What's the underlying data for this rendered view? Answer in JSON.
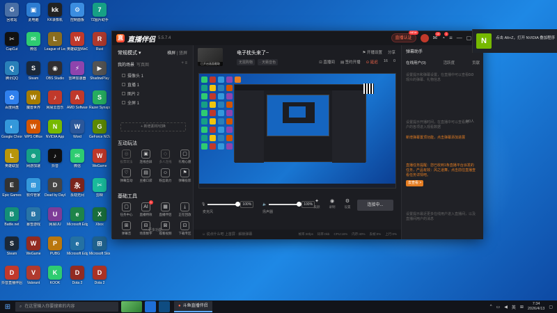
{
  "window": {
    "app_title": "直播伴侣",
    "version": "5.5.7.4",
    "cert_label": "直播认证",
    "cert_badge": "NEW",
    "notif_badge": "10",
    "notif_badge2": "1"
  },
  "left": {
    "mode_label": "常规模式 ▾",
    "mode_h": "横屏",
    "mode_v": "竖屏",
    "scene_title": "我的场景",
    "scene_sub": "写真图",
    "scene_ops": "+ ≡",
    "sources": [
      "摄像头 1",
      "直播 1",
      "图片 2",
      "全屏 1"
    ],
    "add_source": "+ 新增素材/切换",
    "section1": "互动玩法",
    "grid1": [
      {
        "icon": "◎",
        "label": "投票玩法",
        "dim": true
      },
      {
        "icon": "▣",
        "label": "连线合屏",
        "dim": false
      },
      {
        "icon": "◇",
        "label": "多人连线",
        "dim": true
      },
      {
        "icon": "▢",
        "label": "礼物心愿",
        "dim": false
      },
      {
        "icon": "♡",
        "label": "弹幕互动",
        "dim": false
      },
      {
        "icon": "▤",
        "label": "主播口袋",
        "dim": false
      },
      {
        "icon": "☺",
        "label": "粉丝助力",
        "dim": false
      },
      {
        "icon": "⚑",
        "label": "弹幕投影",
        "dim": false
      }
    ],
    "section2": "基础工具",
    "grid2": [
      {
        "icon": "▢",
        "label": "任务中心",
        "dim": false
      },
      {
        "icon": "AI",
        "label": "直播特效",
        "dim": false,
        "badge": "1"
      },
      {
        "icon": "▦",
        "label": "直播伴侣",
        "dim": false
      },
      {
        "icon": "⤓",
        "label": "正在回放",
        "dim": false
      },
      {
        "icon": "⊞",
        "label": "弹幕音",
        "dim": false
      },
      {
        "icon": "⊟",
        "label": "场景数字",
        "dim": false
      },
      {
        "icon": "⊠",
        "label": "观看视频",
        "dim": false
      },
      {
        "icon": "⊡",
        "label": "下载专区",
        "dim": false
      }
    ],
    "more": "••• 更多功能"
  },
  "center": {
    "thumb_label": "已开启画面截取",
    "room_title": "电子枕头来了~",
    "top_links": [
      "⚑ 开播设置",
      "分享"
    ],
    "tags": [
      "无需购物",
      "· 天籁音色"
    ],
    "top_links2": [
      "⊡ 直播间",
      "▤ 签约开播",
      "⊙ 延迟"
    ],
    "top_counts": [
      "16",
      "0"
    ],
    "controls": {
      "mic_label": "麦克风",
      "mic_pct": "100%",
      "speaker_label": "扬声器",
      "speaker_pct": "100%",
      "mic_value": 1.0,
      "speaker_value": 1.0,
      "icons": [
        {
          "icon": "✦",
          "label": "美颜"
        },
        {
          "icon": "◉",
          "label": "录制"
        },
        {
          "icon": "⚙",
          "label": "设置"
        }
      ],
      "live_button": "连接中..."
    },
    "chat_placeholder": "☺ 说点什么吧 上首屏 · 解锁弹幕",
    "stats": [
      "帧率:30fps",
      "码率:0kb",
      "CPU:16%",
      "内存:40%",
      "丢帧:0%",
      "上行:0%"
    ]
  },
  "right": {
    "header": "弹幕助手",
    "tabs": [
      "在线用户(0)",
      "活跃度",
      "贡献"
    ],
    "note1": "设置提示和弹幕设置，在直播中可以查看观众的弹幕、礼物信息",
    "count1": "0.0",
    "note2": "设置提示开播时间，在直播中可以查看用户的各项进入观看数据",
    "count2": "0/0人",
    "hl1": "新增弹幕置顶功能，点击弹幕添加进展",
    "hl2": "直播任务提醒：您已收到1条直播平台派发的任务，产品有效：风之道舞，点击前往直播查看任务详情吧。",
    "go_view": "去查看 >",
    "note3": "设置提示最近更多在线用户进入直播间，以及直播间用户的消息"
  },
  "notification": {
    "text": "点击 Alt+Z，打开 NVIDIA 叠加程序"
  },
  "desktop": {
    "icons": [
      {
        "label": "回收站",
        "color": "#4a6fa5",
        "glyph": "♻"
      },
      {
        "label": "此电脑",
        "color": "#2d7dd2",
        "glyph": "▣"
      },
      {
        "label": "KK录像机",
        "color": "#222",
        "glyph": "kk"
      },
      {
        "label": "控制面板",
        "color": "#3b8de0",
        "glyph": "⚙"
      },
      {
        "label": "7Z图片助手",
        "color": "#16a085",
        "glyph": "7"
      },
      {
        "label": "CapCut",
        "color": "#111",
        "glyph": "✂"
      },
      {
        "label": "微信",
        "color": "#2ecc71",
        "glyph": "✉"
      },
      {
        "label": "League of Legends",
        "color": "#8a6d1f",
        "glyph": "L"
      },
      {
        "label": "英雄联盟WeGame",
        "color": "#c0392b",
        "glyph": "W"
      },
      {
        "label": "Rust",
        "color": "#b03a2e",
        "glyph": "R"
      },
      {
        "label": "腾讯QQ",
        "color": "#2980b9",
        "glyph": "Q"
      },
      {
        "label": "Steam",
        "color": "#1b2838",
        "glyph": "S"
      },
      {
        "label": "OBS Studio",
        "color": "#302e31",
        "glyph": "◉"
      },
      {
        "label": "雷神加速器",
        "color": "#8e44ad",
        "glyph": "⚡"
      },
      {
        "label": "ShadowPlay",
        "color": "#555",
        "glyph": "▶"
      },
      {
        "label": "百度网盘",
        "color": "#2f80ed",
        "glyph": "✿"
      },
      {
        "label": "魔兽世界",
        "color": "#a67c00",
        "glyph": "W"
      },
      {
        "label": "网易云音乐",
        "color": "#c0392b",
        "glyph": "♪"
      },
      {
        "label": "AMD Software",
        "color": "#c0392b",
        "glyph": "A"
      },
      {
        "label": "Razer Synapse",
        "color": "#27ae60",
        "glyph": "S"
      },
      {
        "label": "Google Chrome",
        "color": "#3498db",
        "glyph": "◐"
      },
      {
        "label": "WPS Office",
        "color": "#d35400",
        "glyph": "W"
      },
      {
        "label": "NVIDIA App",
        "color": "#76b900",
        "glyph": "N"
      },
      {
        "label": "Word",
        "color": "#2b579a",
        "glyph": "W"
      },
      {
        "label": "GeForce NOW",
        "color": "#5d8a00",
        "glyph": "G"
      },
      {
        "label": "英雄联盟",
        "color": "#b7950b",
        "glyph": "L"
      },
      {
        "label": "网游加速",
        "color": "#16a085",
        "glyph": "⊕"
      },
      {
        "label": "抖音",
        "color": "#111",
        "glyph": "♪"
      },
      {
        "label": "微信",
        "color": "#2ecc71",
        "glyph": "✉"
      },
      {
        "label": "WeGame",
        "color": "#c0392b",
        "glyph": "W"
      },
      {
        "label": "Epic Games",
        "color": "#333",
        "glyph": "E"
      },
      {
        "label": "软件管家",
        "color": "#3498db",
        "glyph": "⊞"
      },
      {
        "label": "Dead by Daylight",
        "color": "#444",
        "glyph": "D"
      },
      {
        "label": "永劫无间",
        "color": "#7b241c",
        "glyph": "永"
      },
      {
        "label": "剪映",
        "color": "#1abc9c",
        "glyph": "✂"
      },
      {
        "label": "Battle.net",
        "color": "#148f77",
        "glyph": "B"
      },
      {
        "label": "暴雪游戏",
        "color": "#2874a6",
        "glyph": "B"
      },
      {
        "label": "网易UU",
        "color": "#7d3c98",
        "glyph": "U"
      },
      {
        "label": "Microsoft Edge",
        "color": "#1e8449",
        "glyph": "e"
      },
      {
        "label": "Xbox",
        "color": "#196f3d",
        "glyph": "X"
      },
      {
        "label": "Steam",
        "color": "#1b2838",
        "glyph": "S"
      },
      {
        "label": "WeGame",
        "color": "#922b21",
        "glyph": "W"
      },
      {
        "label": "PUBG",
        "color": "#b9770e",
        "glyph": "P"
      },
      {
        "label": "Microsoft Edge",
        "color": "#2471a3",
        "glyph": "e"
      },
      {
        "label": "Microsoft Store",
        "color": "#1f618d",
        "glyph": "⊞"
      },
      {
        "label": "抖音直播伴侣",
        "color": "#c0392b",
        "glyph": "D"
      },
      {
        "label": "Valorant",
        "color": "#b03a2e",
        "glyph": "V"
      },
      {
        "label": "KOOK",
        "color": "#2ecc71",
        "glyph": "K"
      },
      {
        "label": "Dota 2",
        "color": "#922b21",
        "glyph": "D"
      },
      {
        "label": "Dota 2",
        "color": "#a93226",
        "glyph": "D"
      }
    ]
  },
  "taskbar": {
    "search_placeholder": "在这里输入你要搜索的内容",
    "active_app": "斗鱼直播伴侣",
    "lang": "英",
    "time": "7:34",
    "date": "2026/4/13"
  }
}
